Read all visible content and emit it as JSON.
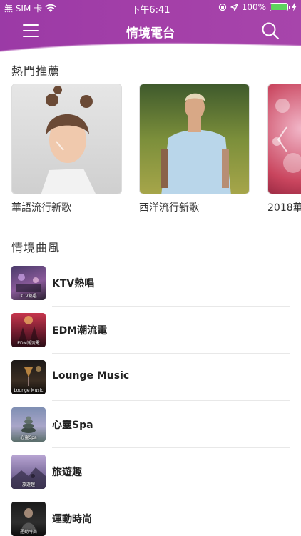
{
  "status_bar": {
    "carrier": "無 SIM 卡",
    "time": "下午6:41",
    "battery": "100%",
    "battery_level": 1.0
  },
  "nav": {
    "title": "情境電台",
    "menu_icon": "hamburger-menu-icon",
    "search_icon": "search-icon"
  },
  "featured": {
    "heading": "熱門推薦",
    "cards": [
      {
        "label": "華語流行新歌"
      },
      {
        "label": "西洋流行新歌"
      },
      {
        "label": "2018華"
      }
    ]
  },
  "genres": {
    "heading": "情境曲風",
    "items": [
      {
        "name": "KTV熱唱",
        "caption": "KTV熱唱"
      },
      {
        "name": "EDM潮流電",
        "caption": "EDM潮流電"
      },
      {
        "name": "Lounge Music",
        "caption": "Lounge Music"
      },
      {
        "name": "心靈Spa",
        "caption": "心靈Spa"
      },
      {
        "name": "旅遊趣",
        "caption": "旅遊趣"
      },
      {
        "name": "運動時尚",
        "caption": "運動時尚"
      }
    ]
  },
  "colors": {
    "accent": "#a03fa8",
    "battery_fill": "#5ed35e"
  }
}
